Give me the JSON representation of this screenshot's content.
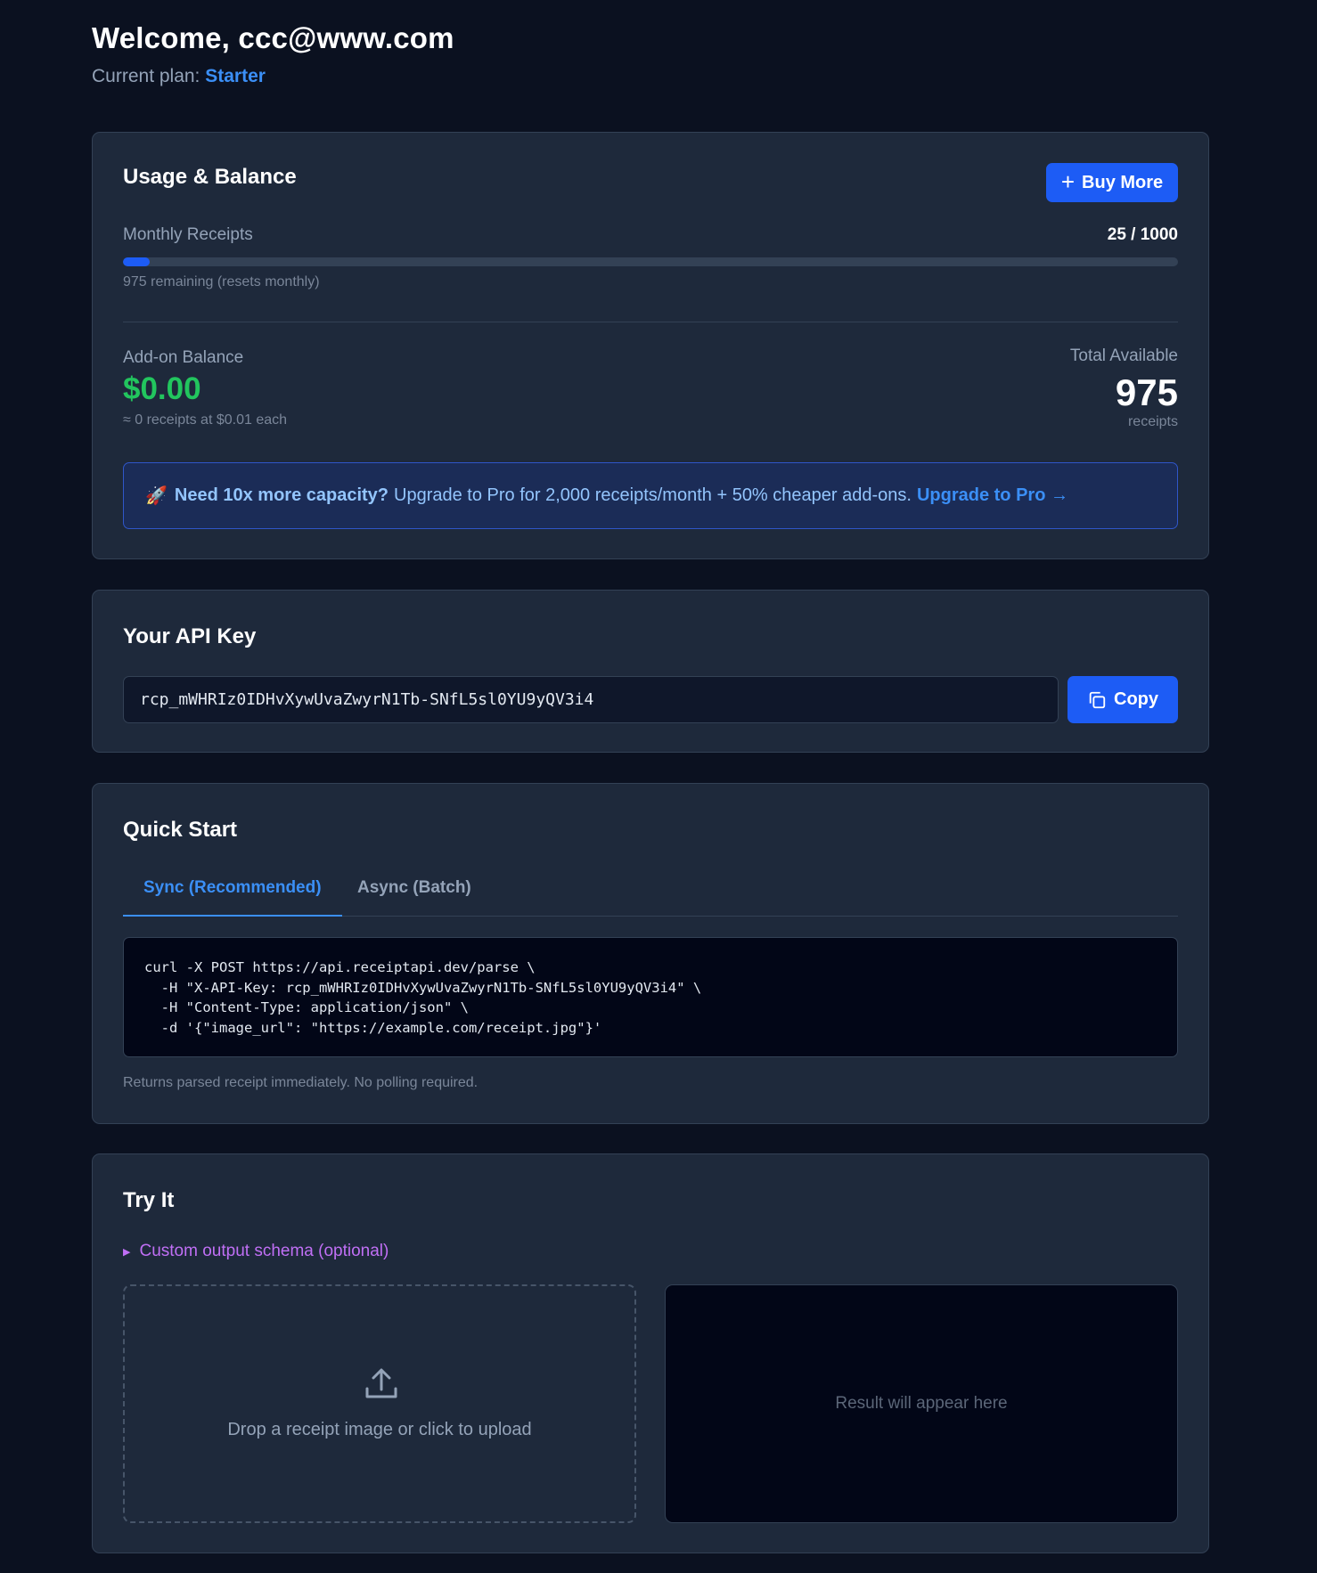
{
  "header": {
    "welcome": "Welcome, ccc@www.com",
    "plan_prefix": "Current plan:",
    "plan_name": "Starter"
  },
  "usage": {
    "title": "Usage & Balance",
    "buy_more_label": "Buy More",
    "monthly_label": "Monthly Receipts",
    "used": 25,
    "limit": 1000,
    "count_text": "25 / 1000",
    "progress_fraction": 0.025,
    "remaining_text": "975 remaining (resets monthly)",
    "addon_label": "Add-on Balance",
    "addon_amount": "$0.00",
    "addon_note": "≈ 0 receipts at $0.01 each",
    "total_label": "Total Available",
    "total_value": "975",
    "total_unit": "receipts",
    "upgrade": {
      "icon": "rocket-icon",
      "bold": "Need 10x more capacity?",
      "text": "Upgrade to Pro for 2,000 receipts/month + 50% cheaper add-ons.",
      "link": "Upgrade to Pro →"
    }
  },
  "api": {
    "title": "Your API Key",
    "key": "rcp_mWHRIz0IDHvXywUvaZwyrN1Tb-SNfL5sl0YU9yQV3i4",
    "copy_label": "Copy"
  },
  "quickstart": {
    "title": "Quick Start",
    "tabs": [
      {
        "label": "Sync (Recommended)",
        "active": true
      },
      {
        "label": "Async (Batch)",
        "active": false
      }
    ],
    "code_lines": [
      "curl -X POST https://api.receiptapi.dev/parse \\",
      "  -H \"X-API-Key: rcp_mWHRIz0IDHvXywUvaZwyrN1Tb-SNfL5sl0YU9yQV3i4\" \\",
      "  -H \"Content-Type: application/json\" \\",
      "  -d '{\"image_url\": \"https://example.com/receipt.jpg\"}'"
    ],
    "note": "Returns parsed receipt immediately. No polling required."
  },
  "try_it": {
    "title": "Try It",
    "schema_toggle": "Custom output schema (optional)",
    "drop_text": "Drop a receipt image or click to upload",
    "result_placeholder": "Result will appear here"
  },
  "colors": {
    "background": "#0b1120",
    "card": "#1e293b",
    "accent": "#1d5cf5",
    "link": "#3b8ff6",
    "success": "#22c55e",
    "schema": "#c06ff5"
  }
}
